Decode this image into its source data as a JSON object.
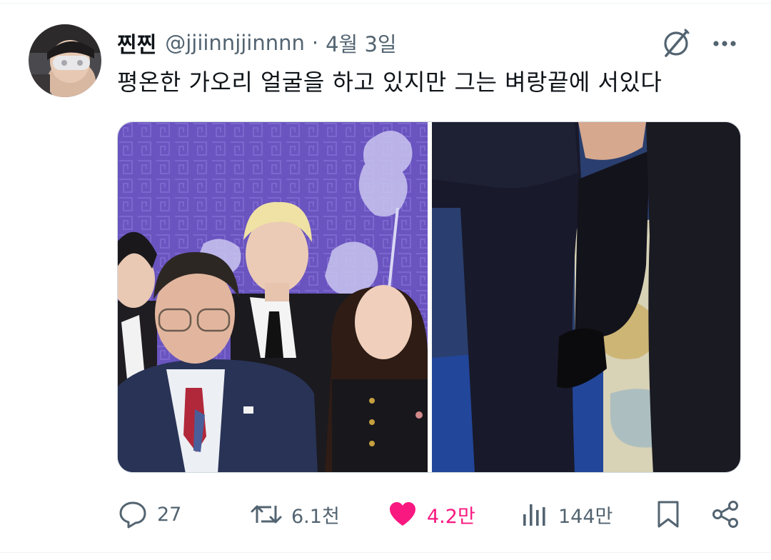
{
  "tweet": {
    "author": {
      "display_name": "찐찐",
      "handle": "@jjiinnjjinnnn",
      "separator": "·",
      "date": "4월 3일"
    },
    "text": "평온한 가오리 얼굴을 하고 있지만 그는 벼랑끝에 서있다",
    "media": [
      {
        "kind": "photo",
        "name": "group-photo"
      },
      {
        "kind": "photo",
        "name": "legs-closeup-photo"
      }
    ]
  },
  "actions": {
    "reply": {
      "icon": "reply-icon",
      "count": "27"
    },
    "retweet": {
      "icon": "retweet-icon",
      "count": "6.1천"
    },
    "like": {
      "icon": "heart-icon",
      "count": "4.2만",
      "color": "#f91880",
      "active": true
    },
    "views": {
      "icon": "views-icon",
      "count": "144만"
    },
    "bookmark": {
      "icon": "bookmark-icon"
    },
    "share": {
      "icon": "share-icon"
    }
  },
  "colors": {
    "text": "#0f1419",
    "secondary": "#536471",
    "like": "#f91880",
    "border": "#cfd9de"
  }
}
